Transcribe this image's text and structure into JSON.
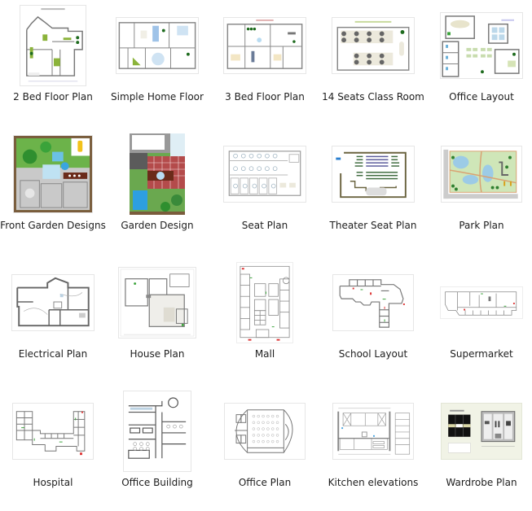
{
  "gallery": {
    "items": [
      {
        "label": "2 Bed Floor Plan",
        "thumb": "floorplan-2bed"
      },
      {
        "label": "Simple Home Floor",
        "thumb": "floorplan-simple-home"
      },
      {
        "label": "3 Bed Floor Plan",
        "thumb": "floorplan-3bed"
      },
      {
        "label": "14 Seats Class Room",
        "thumb": "classroom"
      },
      {
        "label": "Office Layout",
        "thumb": "office-layout"
      },
      {
        "label": "Front Garden Designs",
        "thumb": "front-garden"
      },
      {
        "label": "Garden Design",
        "thumb": "garden"
      },
      {
        "label": "Seat Plan",
        "thumb": "seat-plan"
      },
      {
        "label": "Theater Seat Plan",
        "thumb": "theater"
      },
      {
        "label": "Park Plan",
        "thumb": "park"
      },
      {
        "label": "Electrical Plan",
        "thumb": "electrical"
      },
      {
        "label": "House Plan",
        "thumb": "house"
      },
      {
        "label": "Mall",
        "thumb": "mall"
      },
      {
        "label": "School Layout",
        "thumb": "school"
      },
      {
        "label": "Supermarket",
        "thumb": "supermarket"
      },
      {
        "label": "Hospital",
        "thumb": "hospital"
      },
      {
        "label": "Office Building",
        "thumb": "office-building"
      },
      {
        "label": "Office Plan",
        "thumb": "office-plan"
      },
      {
        "label": "Kitchen elevations",
        "thumb": "kitchen"
      },
      {
        "label": "Wardrobe Plan",
        "thumb": "wardrobe"
      }
    ]
  }
}
